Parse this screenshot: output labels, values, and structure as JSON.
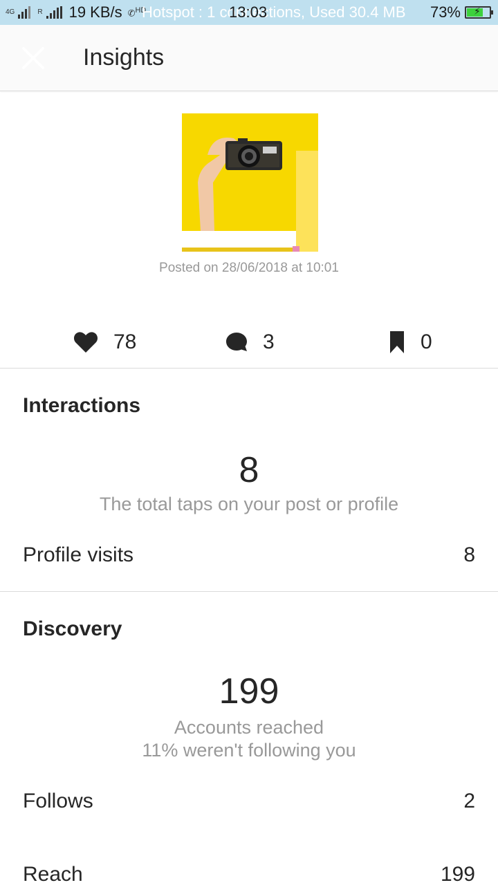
{
  "status_bar": {
    "network_tag": "4G",
    "roaming_tag": "R",
    "speed": "19 KB/s",
    "call_tag": "HD",
    "notification": "Hotspot : 1 connections, Used 30.4 MB",
    "time": "13:03",
    "battery_percent": "73%",
    "battery_level": 0.73,
    "battery_color": "#3dd13d"
  },
  "header": {
    "title": "Insights"
  },
  "post": {
    "posted_on": "Posted on 28/06/2018 at 10:01",
    "image_bg": "#f7d800"
  },
  "stats": {
    "likes": "78",
    "comments": "3",
    "saves": "0"
  },
  "interactions": {
    "title": "Interactions",
    "total": "8",
    "total_caption": "The total taps on your post or profile",
    "rows": [
      {
        "label": "Profile visits",
        "value": "8"
      }
    ]
  },
  "discovery": {
    "title": "Discovery",
    "total": "199",
    "caption_line1": "Accounts reached",
    "caption_line2": "11% weren't following you",
    "rows": [
      {
        "label": "Follows",
        "value": "2"
      },
      {
        "label": "Reach",
        "value": "199"
      }
    ]
  }
}
